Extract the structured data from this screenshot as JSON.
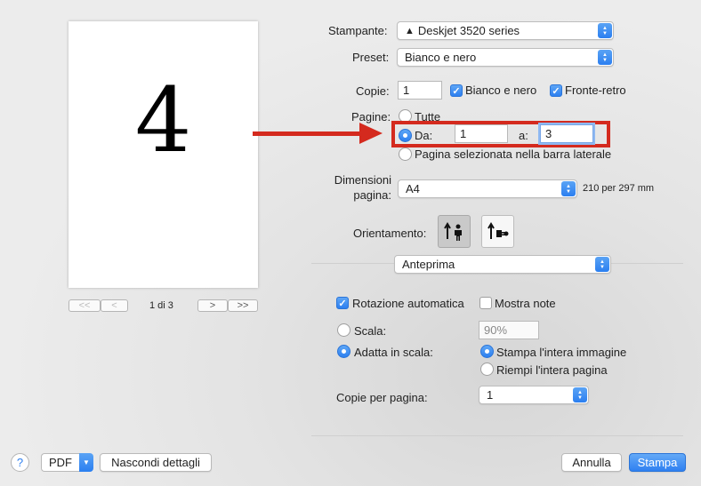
{
  "preview": {
    "page_number_digit": "4",
    "pager_first": "<<",
    "pager_prev": "<",
    "pager_label": "1 di 3",
    "pager_next": ">",
    "pager_last": ">>"
  },
  "printer": {
    "label": "Stampante:",
    "value": "Deskjet 3520 series",
    "warning_icon": "warning-triangle-icon"
  },
  "preset": {
    "label": "Preset:",
    "value": "Bianco e nero"
  },
  "copies": {
    "label": "Copie:",
    "value": "1",
    "bw_label": "Bianco e nero",
    "bw_checked": true,
    "duplex_label": "Fronte-retro",
    "duplex_checked": true
  },
  "pages": {
    "label": "Pagine:",
    "all_label": "Tutte",
    "from_label": "Da:",
    "from_value": "1",
    "to_label": "a:",
    "to_value": "3",
    "sidebar_label": "Pagina selezionata nella barra laterale",
    "selected": "from"
  },
  "paper_size": {
    "label_line1": "Dimensioni",
    "label_line2": "pagina:",
    "value": "A4",
    "dims": "210 per 297 mm"
  },
  "orientation": {
    "label": "Orientamento:",
    "selected": "portrait"
  },
  "section_popup": {
    "value": "Anteprima"
  },
  "preview_options": {
    "auto_rotate_label": "Rotazione automatica",
    "auto_rotate_checked": true,
    "show_notes_label": "Mostra note",
    "show_notes_checked": false,
    "scale_label": "Scala:",
    "scale_value": "90%",
    "fit_label": "Adatta in scala:",
    "fit_selected": true,
    "print_entire_label": "Stampa l'intera immagine",
    "fill_page_label": "Riempi l'intera pagina",
    "copies_per_page_label": "Copie per pagina:",
    "copies_per_page_value": "1"
  },
  "footer": {
    "help": "?",
    "pdf_label": "PDF",
    "hide_details": "Nascondi dettagli",
    "cancel": "Annulla",
    "print": "Stampa"
  },
  "colors": {
    "accent": "#2d7ff0",
    "highlight_red": "#d42a1e"
  }
}
